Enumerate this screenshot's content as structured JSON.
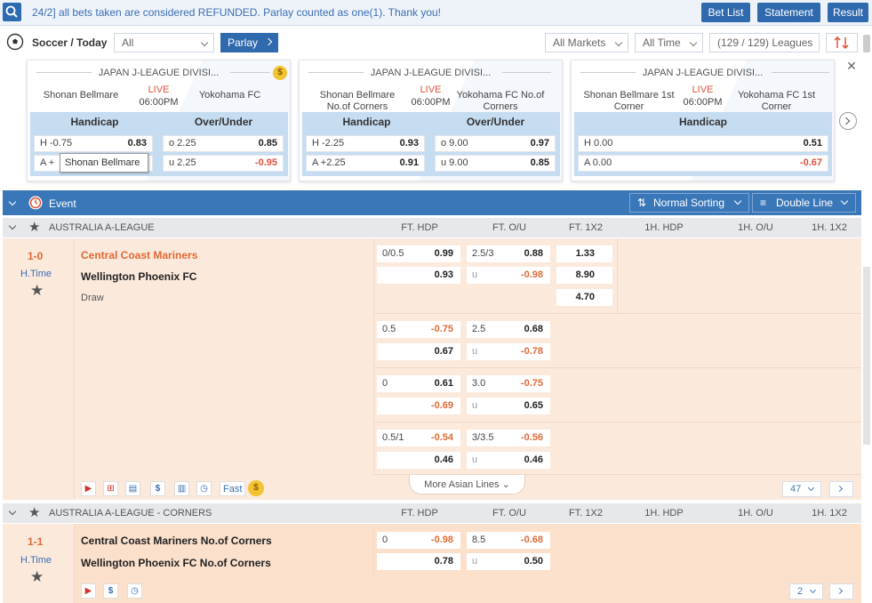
{
  "topbar": {
    "notice": "24/2] all bets taken are considered REFUNDED. Parlay counted as one(1). Thank you!",
    "bet_list": "Bet List",
    "statement": "Statement",
    "result": "Result"
  },
  "filters": {
    "sport_label": "Soccer / Today",
    "all_select": "All",
    "parlay": "Parlay",
    "all_markets": "All Markets",
    "all_time": "All Time",
    "leagues": "(129 / 129) Leagues"
  },
  "cards": [
    {
      "league": "JAPAN J-LEAGUE DIVISI...",
      "home": "Shonan Bellmare",
      "away": "Yokohama FC",
      "live": "LIVE",
      "time": "06:00PM",
      "col1": "Handicap",
      "col2": "Over/Under",
      "r1": {
        "l1": "H -0.75",
        "v1": "0.83",
        "l2": "o 2.25",
        "v2": "0.85"
      },
      "r2": {
        "l1": "A +",
        "v1": "",
        "l2": "u 2.25",
        "v2": "-0.95"
      },
      "tooltip": "Shonan Bellmare"
    },
    {
      "league": "JAPAN J-LEAGUE DIVISI...",
      "home": "Shonan Bellmare No.of Corners",
      "away": "Yokohama FC No.of Corners",
      "live": "LIVE",
      "time": "06:00PM",
      "col1": "Handicap",
      "col2": "Over/Under",
      "r1": {
        "l1": "H -2.25",
        "v1": "0.93",
        "l2": "o 9.00",
        "v2": "0.97"
      },
      "r2": {
        "l1": "A +2.25",
        "v1": "0.91",
        "l2": "u 9.00",
        "v2": "0.85"
      }
    },
    {
      "league": "JAPAN J-LEAGUE DIVISI...",
      "home": "Shonan Bellmare 1st Corner",
      "away": "Yokohama FC 1st Corner",
      "live": "LIVE",
      "time": "06:00PM",
      "col1": "Handicap",
      "r1": {
        "l1": "H 0.00",
        "v1": "0.51"
      },
      "r2": {
        "l1": "A 0.00",
        "v1": "-0.67"
      }
    }
  ],
  "eventbar": {
    "label": "Event",
    "sorting": "Normal Sorting",
    "line": "Double Line"
  },
  "columns": [
    "FT. HDP",
    "FT. O/U",
    "FT. 1X2",
    "1H. HDP",
    "1H. O/U",
    "1H. 1X2"
  ],
  "league1": {
    "name": "AUSTRALIA A-LEAGUE",
    "score": "1-0",
    "period": "H.Time",
    "home": "Central Coast Mariners",
    "away": "Wellington Phoenix FC",
    "draw": "Draw",
    "lines": [
      {
        "hdp": "0/0.5",
        "h1": "0.99",
        "h2": "0.93",
        "ou": "2.5/3",
        "o1": "0.88",
        "ou_u": "u",
        "o2": "-0.98"
      },
      {
        "hdp": "0.5",
        "h1": "-0.75",
        "h2": "0.67",
        "ou": "2.5",
        "o1": "0.68",
        "ou_u": "u",
        "o2": "-0.78"
      },
      {
        "hdp": "0",
        "h1": "0.61",
        "h2": "-0.69",
        "ou": "3.0",
        "o1": "-0.75",
        "ou_u": "u",
        "o2": "0.65"
      },
      {
        "hdp": "0.5/1",
        "h1": "-0.54",
        "h2": "0.46",
        "ou": "3/3.5",
        "o1": "-0.56",
        "ou_u": "u",
        "o2": "0.46"
      }
    ],
    "x12": [
      "1.33",
      "8.90",
      "4.70"
    ],
    "fast": "Fast",
    "more": "More Asian Lines",
    "count": "47"
  },
  "league2": {
    "name": "AUSTRALIA A-LEAGUE - CORNERS",
    "score": "1-1",
    "period": "H.Time",
    "home": "Central Coast Mariners No.of Corners",
    "away": "Wellington Phoenix FC No.of Corners",
    "line": {
      "hdp": "0",
      "h1": "-0.98",
      "h2": "0.78",
      "ou": "8.5",
      "o1": "-0.68",
      "ou_u": "u",
      "o2": "0.50"
    },
    "count": "2"
  },
  "colors": {
    "accent": "#2f69ae",
    "live": "#e0503a",
    "negative": "#e06a36",
    "match_bg": "#fbe9dc"
  }
}
